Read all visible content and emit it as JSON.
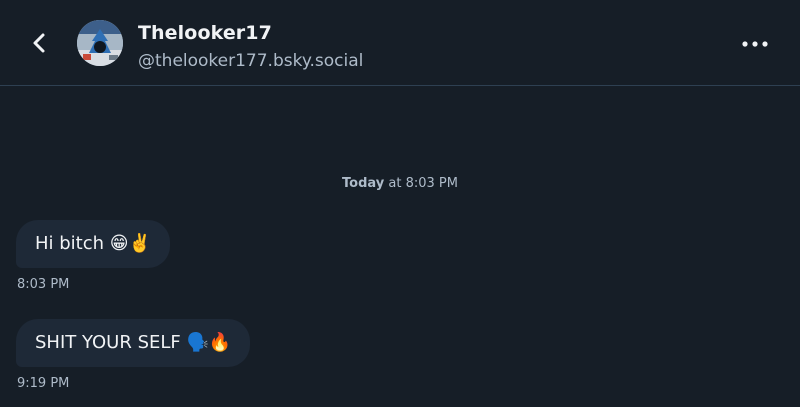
{
  "header": {
    "display_name": "Thelooker17",
    "handle": "@thelooker177.bsky.social",
    "back_icon": "chevron-left-icon",
    "more_icon": "ellipsis-icon"
  },
  "conversation": {
    "date_separator": {
      "day": "Today",
      "rest": " at 8:03 PM"
    },
    "messages": [
      {
        "text": "Hi bitch 😁✌️",
        "time": "8:03 PM"
      },
      {
        "text": "SHIT YOUR SELF 🗣️🔥",
        "time": "9:19 PM"
      }
    ]
  },
  "colors": {
    "background": "#161e27",
    "bubble": "#1e2937",
    "divider": "#2e4052",
    "muted_text": "#aebbc9",
    "primary_text": "#f1f3f5"
  }
}
